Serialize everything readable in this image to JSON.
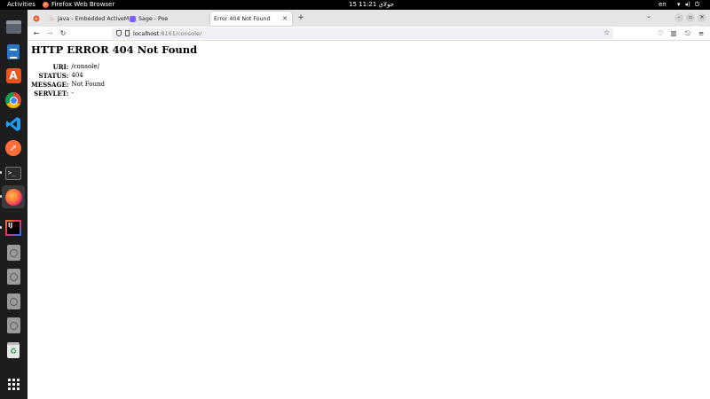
{
  "topbar": {
    "activities": "Activities",
    "app_name": "Firefox Web Browser",
    "clock": "15 جولاي  11:21",
    "language": "en"
  },
  "dock": {
    "items": [
      {
        "name": "files",
        "icon": "files-icon"
      },
      {
        "name": "libreoffice-writer",
        "icon": "writer-icon"
      },
      {
        "name": "software-center",
        "icon": "store-icon"
      },
      {
        "name": "google-chrome",
        "icon": "chrome-icon"
      },
      {
        "name": "vscode",
        "icon": "vscode-icon"
      },
      {
        "name": "postman",
        "icon": "postman-icon"
      },
      {
        "name": "terminal",
        "icon": "terminal-icon"
      },
      {
        "name": "firefox",
        "icon": "firefox-icon"
      },
      {
        "name": "intellij-idea",
        "icon": "idea-icon"
      },
      {
        "name": "drive-1",
        "icon": "drive-icon"
      },
      {
        "name": "drive-2",
        "icon": "drive-icon"
      },
      {
        "name": "drive-3",
        "icon": "drive-icon"
      },
      {
        "name": "drive-4",
        "icon": "drive-icon"
      },
      {
        "name": "trash",
        "icon": "trash-icon"
      },
      {
        "name": "show-apps",
        "icon": "app-grid-icon"
      }
    ],
    "terminal_glyph": ">_",
    "idea_glyph": "IJ"
  },
  "browser": {
    "tabs": [
      {
        "title": "java - Embedded ActiveM",
        "favicon": "java-icon",
        "selected": false
      },
      {
        "title": "Sage - Poe",
        "favicon": "poe-icon",
        "selected": false
      },
      {
        "title": "Error 404 Not Found",
        "favicon": "",
        "selected": true
      }
    ],
    "url": {
      "host": "localhost",
      "rest": ":8161/console/"
    }
  },
  "page": {
    "heading": "HTTP ERROR 404 Not Found",
    "rows": [
      {
        "label": "URI:",
        "value": "/console/"
      },
      {
        "label": "STATUS:",
        "value": "404"
      },
      {
        "label": "MESSAGE:",
        "value": "Not Found"
      },
      {
        "label": "SERVLET:",
        "value": "-"
      }
    ]
  },
  "colors": {
    "topbar": "#000000",
    "dock": "#1d1d1d",
    "tabstrip": "#e5e4e6",
    "urlbar": "#f0f0f4"
  }
}
